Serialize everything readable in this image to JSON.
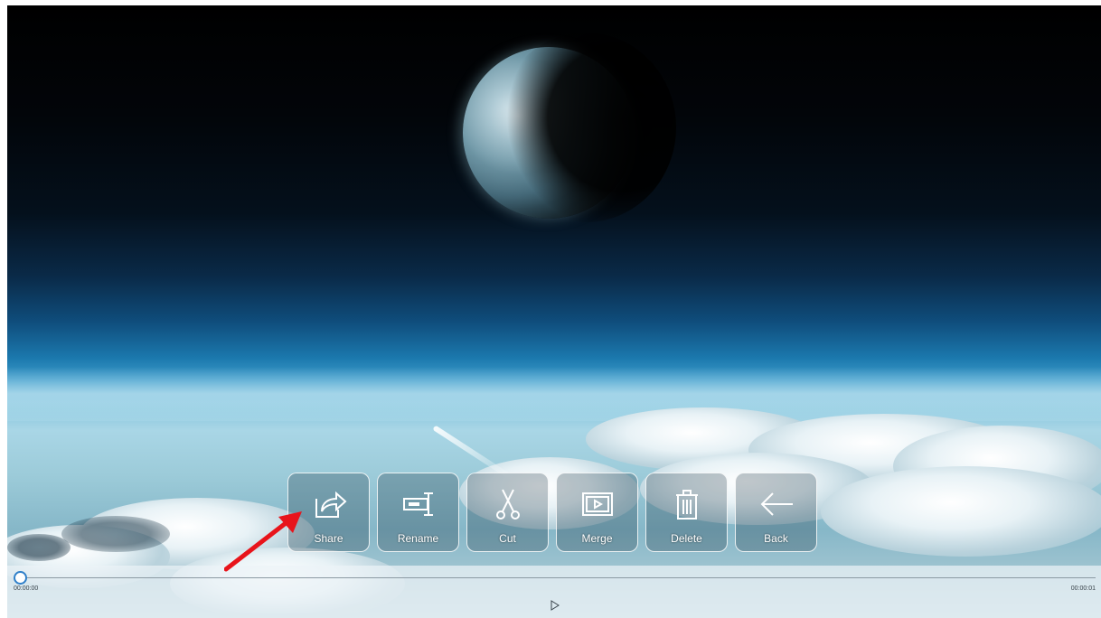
{
  "actions": [
    {
      "label": "Share",
      "icon": "share-icon"
    },
    {
      "label": "Rename",
      "icon": "rename-icon"
    },
    {
      "label": "Cut",
      "icon": "scissors-icon"
    },
    {
      "label": "Merge",
      "icon": "merge-icon"
    },
    {
      "label": "Delete",
      "icon": "trash-icon"
    },
    {
      "label": "Back",
      "icon": "back-arrow-icon"
    }
  ],
  "player": {
    "current_time": "00:00:00",
    "total_time": "00:00:01",
    "progress": 0,
    "play_icon": "play-icon"
  },
  "annotation": {
    "arrow_color": "#e8141b",
    "points_to": "Share"
  },
  "colors": {
    "accent": "#2e7fc9"
  }
}
